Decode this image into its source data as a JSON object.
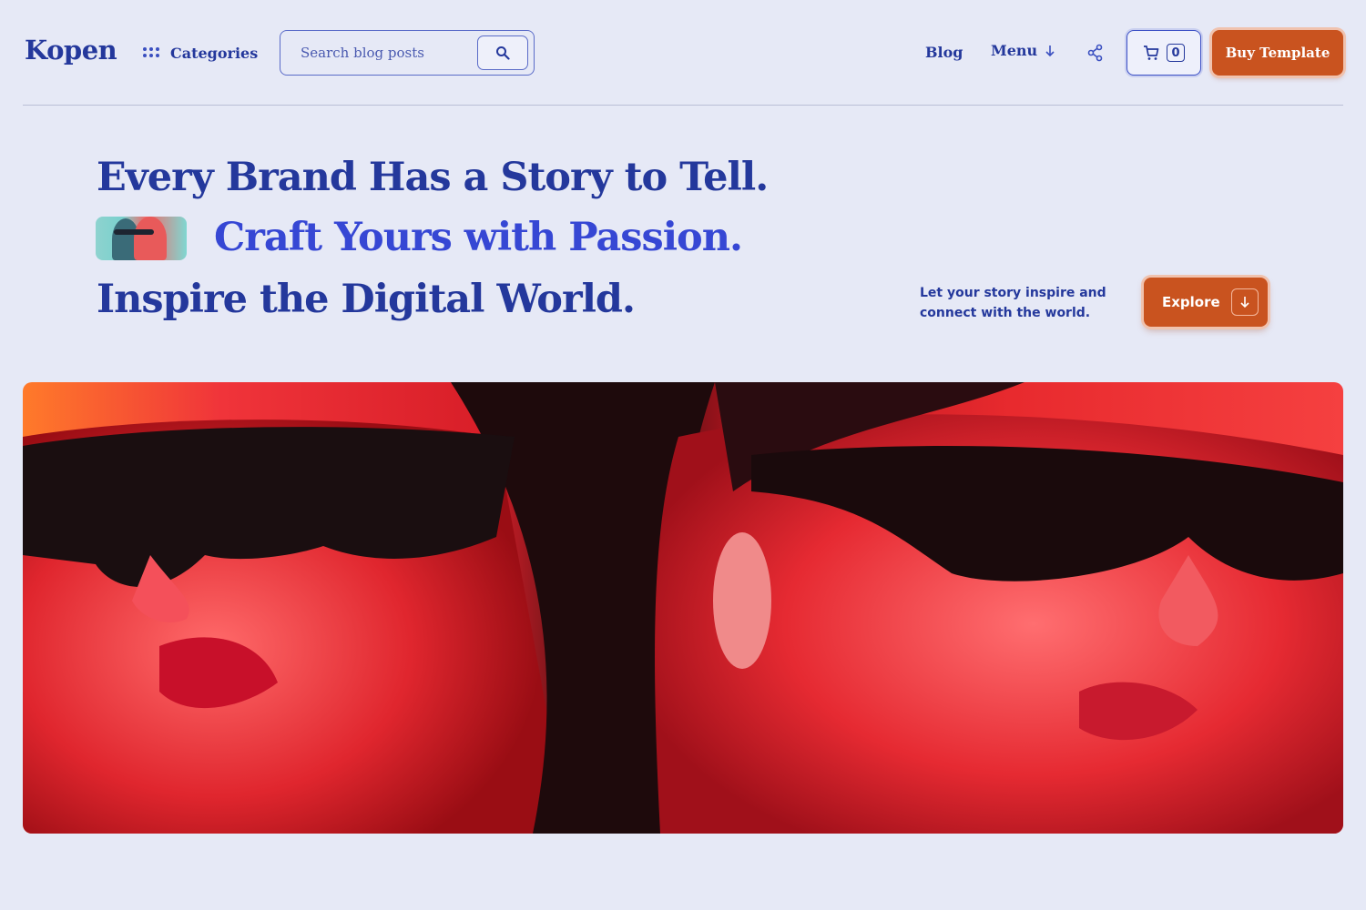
{
  "header": {
    "logo": "Kopen",
    "categories_label": "Categories",
    "search": {
      "placeholder": "Search blog posts",
      "value": ""
    },
    "nav": {
      "blog": "Blog",
      "menu": "Menu"
    },
    "cart_count": "0",
    "buy_label": "Buy Template"
  },
  "hero": {
    "line1": "Every Brand Has a Story to Tell.",
    "line2": "Craft Yours with Passion.",
    "line3": "Inspire the Digital World.",
    "tagline": "Let your story inspire and connect with the world.",
    "explore_label": "Explore"
  },
  "colors": {
    "background": "#e6e9f6",
    "primary_text": "#24389c",
    "accent_text": "#3647d4",
    "cta": "#c9531f"
  },
  "icons": {
    "categories": "grid-dots-icon",
    "search": "search-icon",
    "menu": "arrow-down-icon",
    "share": "share-icon",
    "cart": "cart-icon",
    "explore": "arrow-down-icon"
  }
}
